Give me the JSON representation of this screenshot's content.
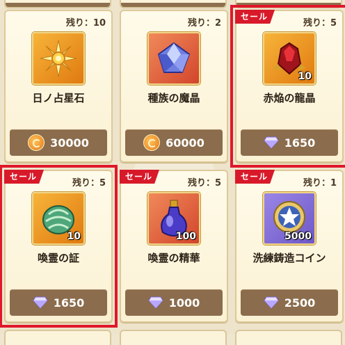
{
  "shop": {
    "items": [
      {
        "name": "日ノ占星石",
        "remaining": "残り：10",
        "price": "30000",
        "currency": "gold-coin",
        "qty": "",
        "sale": false
      },
      {
        "name": "種族の魔晶",
        "remaining": "残り：2",
        "price": "60000",
        "currency": "gold-coin",
        "qty": "",
        "sale": false
      },
      {
        "name": "赤焔の龍晶",
        "remaining": "残り：5",
        "price": "1650",
        "currency": "crystal",
        "qty": "10",
        "sale": true,
        "sale_label": "セール"
      },
      {
        "name": "喚霊の証",
        "remaining": "残り：5",
        "price": "1650",
        "currency": "crystal",
        "qty": "10",
        "sale": true,
        "sale_label": "セール"
      },
      {
        "name": "喚霊の精華",
        "remaining": "残り：5",
        "price": "1000",
        "currency": "crystal",
        "qty": "100",
        "sale": true,
        "sale_label": "セール"
      },
      {
        "name": "洗練鋳造コイン",
        "remaining": "残り：1",
        "price": "2500",
        "currency": "crystal",
        "qty": "5000",
        "sale": true,
        "sale_label": "セール"
      }
    ]
  },
  "colors": {
    "sale_red": "#d8192a",
    "price_bar": "#8b6c4c",
    "card_bg": "#fffbea"
  }
}
